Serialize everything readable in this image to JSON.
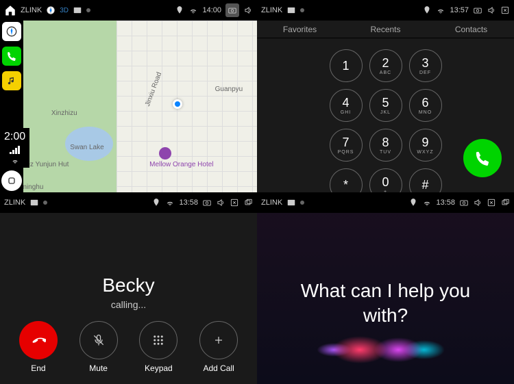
{
  "status": {
    "app": "ZLINK",
    "time1": "14:00",
    "time2": "13:57",
    "time3": "13:58",
    "time4": "13:58",
    "sideClock": "2:00"
  },
  "map": {
    "labels": {
      "road": "Jinxiu Road",
      "area1": "Xinzhizu",
      "area2": "Guanpyu",
      "lake": "Swan Lake",
      "hotel": "Mellow Orange Hotel",
      "hut": "opez Yunjun Hut",
      "minghu": "minghu"
    }
  },
  "dialer": {
    "tabs": [
      "Favorites",
      "Recents",
      "Contacts"
    ],
    "keys": [
      {
        "n": "1",
        "l": ""
      },
      {
        "n": "2",
        "l": "ABC"
      },
      {
        "n": "3",
        "l": "DEF"
      },
      {
        "n": "4",
        "l": "GHI"
      },
      {
        "n": "5",
        "l": "JKL"
      },
      {
        "n": "6",
        "l": "MNO"
      },
      {
        "n": "7",
        "l": "PQRS"
      },
      {
        "n": "8",
        "l": "TUV"
      },
      {
        "n": "9",
        "l": "WXYZ"
      },
      {
        "n": "*",
        "l": ""
      },
      {
        "n": "0",
        "l": "+"
      },
      {
        "n": "#",
        "l": ""
      }
    ]
  },
  "call": {
    "name": "Becky",
    "status": "calling...",
    "btns": {
      "end": "End",
      "mute": "Mute",
      "keypad": "Keypad",
      "add": "Add Call"
    }
  },
  "siri": {
    "prompt": "What can I help you with?"
  }
}
